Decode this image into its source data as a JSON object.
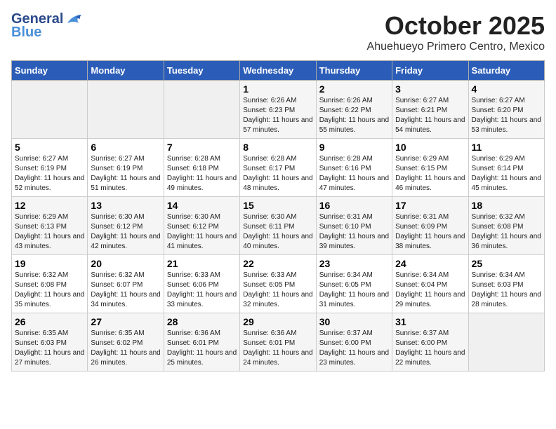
{
  "header": {
    "logo_line1": "General",
    "logo_line2": "Blue",
    "month": "October 2025",
    "location": "Ahuehueyo Primero Centro, Mexico"
  },
  "weekdays": [
    "Sunday",
    "Monday",
    "Tuesday",
    "Wednesday",
    "Thursday",
    "Friday",
    "Saturday"
  ],
  "weeks": [
    [
      {
        "num": "",
        "sunrise": "",
        "sunset": "",
        "daylight": ""
      },
      {
        "num": "",
        "sunrise": "",
        "sunset": "",
        "daylight": ""
      },
      {
        "num": "",
        "sunrise": "",
        "sunset": "",
        "daylight": ""
      },
      {
        "num": "1",
        "sunrise": "Sunrise: 6:26 AM",
        "sunset": "Sunset: 6:23 PM",
        "daylight": "Daylight: 11 hours and 57 minutes."
      },
      {
        "num": "2",
        "sunrise": "Sunrise: 6:26 AM",
        "sunset": "Sunset: 6:22 PM",
        "daylight": "Daylight: 11 hours and 55 minutes."
      },
      {
        "num": "3",
        "sunrise": "Sunrise: 6:27 AM",
        "sunset": "Sunset: 6:21 PM",
        "daylight": "Daylight: 11 hours and 54 minutes."
      },
      {
        "num": "4",
        "sunrise": "Sunrise: 6:27 AM",
        "sunset": "Sunset: 6:20 PM",
        "daylight": "Daylight: 11 hours and 53 minutes."
      }
    ],
    [
      {
        "num": "5",
        "sunrise": "Sunrise: 6:27 AM",
        "sunset": "Sunset: 6:19 PM",
        "daylight": "Daylight: 11 hours and 52 minutes."
      },
      {
        "num": "6",
        "sunrise": "Sunrise: 6:27 AM",
        "sunset": "Sunset: 6:19 PM",
        "daylight": "Daylight: 11 hours and 51 minutes."
      },
      {
        "num": "7",
        "sunrise": "Sunrise: 6:28 AM",
        "sunset": "Sunset: 6:18 PM",
        "daylight": "Daylight: 11 hours and 49 minutes."
      },
      {
        "num": "8",
        "sunrise": "Sunrise: 6:28 AM",
        "sunset": "Sunset: 6:17 PM",
        "daylight": "Daylight: 11 hours and 48 minutes."
      },
      {
        "num": "9",
        "sunrise": "Sunrise: 6:28 AM",
        "sunset": "Sunset: 6:16 PM",
        "daylight": "Daylight: 11 hours and 47 minutes."
      },
      {
        "num": "10",
        "sunrise": "Sunrise: 6:29 AM",
        "sunset": "Sunset: 6:15 PM",
        "daylight": "Daylight: 11 hours and 46 minutes."
      },
      {
        "num": "11",
        "sunrise": "Sunrise: 6:29 AM",
        "sunset": "Sunset: 6:14 PM",
        "daylight": "Daylight: 11 hours and 45 minutes."
      }
    ],
    [
      {
        "num": "12",
        "sunrise": "Sunrise: 6:29 AM",
        "sunset": "Sunset: 6:13 PM",
        "daylight": "Daylight: 11 hours and 43 minutes."
      },
      {
        "num": "13",
        "sunrise": "Sunrise: 6:30 AM",
        "sunset": "Sunset: 6:12 PM",
        "daylight": "Daylight: 11 hours and 42 minutes."
      },
      {
        "num": "14",
        "sunrise": "Sunrise: 6:30 AM",
        "sunset": "Sunset: 6:12 PM",
        "daylight": "Daylight: 11 hours and 41 minutes."
      },
      {
        "num": "15",
        "sunrise": "Sunrise: 6:30 AM",
        "sunset": "Sunset: 6:11 PM",
        "daylight": "Daylight: 11 hours and 40 minutes."
      },
      {
        "num": "16",
        "sunrise": "Sunrise: 6:31 AM",
        "sunset": "Sunset: 6:10 PM",
        "daylight": "Daylight: 11 hours and 39 minutes."
      },
      {
        "num": "17",
        "sunrise": "Sunrise: 6:31 AM",
        "sunset": "Sunset: 6:09 PM",
        "daylight": "Daylight: 11 hours and 38 minutes."
      },
      {
        "num": "18",
        "sunrise": "Sunrise: 6:32 AM",
        "sunset": "Sunset: 6:08 PM",
        "daylight": "Daylight: 11 hours and 36 minutes."
      }
    ],
    [
      {
        "num": "19",
        "sunrise": "Sunrise: 6:32 AM",
        "sunset": "Sunset: 6:08 PM",
        "daylight": "Daylight: 11 hours and 35 minutes."
      },
      {
        "num": "20",
        "sunrise": "Sunrise: 6:32 AM",
        "sunset": "Sunset: 6:07 PM",
        "daylight": "Daylight: 11 hours and 34 minutes."
      },
      {
        "num": "21",
        "sunrise": "Sunrise: 6:33 AM",
        "sunset": "Sunset: 6:06 PM",
        "daylight": "Daylight: 11 hours and 33 minutes."
      },
      {
        "num": "22",
        "sunrise": "Sunrise: 6:33 AM",
        "sunset": "Sunset: 6:05 PM",
        "daylight": "Daylight: 11 hours and 32 minutes."
      },
      {
        "num": "23",
        "sunrise": "Sunrise: 6:34 AM",
        "sunset": "Sunset: 6:05 PM",
        "daylight": "Daylight: 11 hours and 31 minutes."
      },
      {
        "num": "24",
        "sunrise": "Sunrise: 6:34 AM",
        "sunset": "Sunset: 6:04 PM",
        "daylight": "Daylight: 11 hours and 29 minutes."
      },
      {
        "num": "25",
        "sunrise": "Sunrise: 6:34 AM",
        "sunset": "Sunset: 6:03 PM",
        "daylight": "Daylight: 11 hours and 28 minutes."
      }
    ],
    [
      {
        "num": "26",
        "sunrise": "Sunrise: 6:35 AM",
        "sunset": "Sunset: 6:03 PM",
        "daylight": "Daylight: 11 hours and 27 minutes."
      },
      {
        "num": "27",
        "sunrise": "Sunrise: 6:35 AM",
        "sunset": "Sunset: 6:02 PM",
        "daylight": "Daylight: 11 hours and 26 minutes."
      },
      {
        "num": "28",
        "sunrise": "Sunrise: 6:36 AM",
        "sunset": "Sunset: 6:01 PM",
        "daylight": "Daylight: 11 hours and 25 minutes."
      },
      {
        "num": "29",
        "sunrise": "Sunrise: 6:36 AM",
        "sunset": "Sunset: 6:01 PM",
        "daylight": "Daylight: 11 hours and 24 minutes."
      },
      {
        "num": "30",
        "sunrise": "Sunrise: 6:37 AM",
        "sunset": "Sunset: 6:00 PM",
        "daylight": "Daylight: 11 hours and 23 minutes."
      },
      {
        "num": "31",
        "sunrise": "Sunrise: 6:37 AM",
        "sunset": "Sunset: 6:00 PM",
        "daylight": "Daylight: 11 hours and 22 minutes."
      },
      {
        "num": "",
        "sunrise": "",
        "sunset": "",
        "daylight": ""
      }
    ]
  ]
}
